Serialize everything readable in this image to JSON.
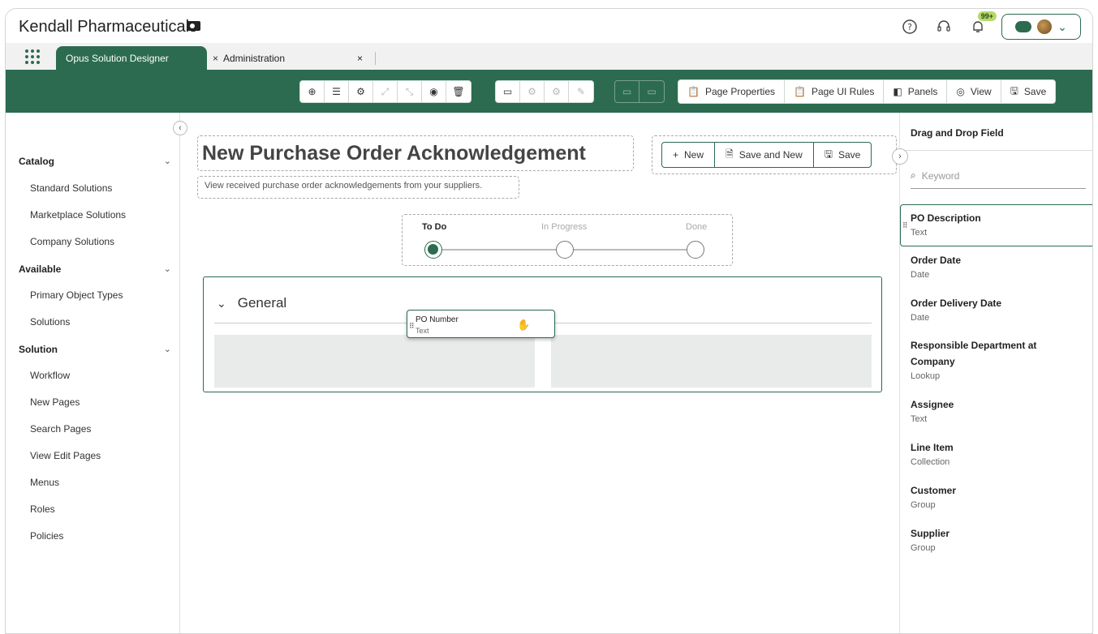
{
  "app": {
    "brand": "Kendall Pharmaceuticals",
    "notifications_badge": "99+"
  },
  "tabs": [
    {
      "label": "Opus Solution Designer",
      "close": "×"
    },
    {
      "label": "Administration",
      "close": "×"
    }
  ],
  "toolbar": {
    "page_properties": "Page Properties",
    "page_ui_rules": "Page UI Rules",
    "panels": "Panels",
    "view": "View",
    "save": "Save"
  },
  "sidebar": {
    "collapse_glyph": "‹",
    "sections": [
      {
        "title": "Catalog",
        "items": [
          "Standard Solutions",
          "Marketplace Solutions",
          "Company Solutions"
        ]
      },
      {
        "title": "Available",
        "items": [
          "Primary Object Types",
          "Solutions"
        ]
      },
      {
        "title": "Solution",
        "items": [
          "Workflow",
          "New Pages",
          "Search Pages",
          "View Edit Pages",
          "Menus",
          "Roles",
          "Policies"
        ]
      }
    ]
  },
  "canvas": {
    "title": "New Purchase Order Acknowledgement",
    "description": "View received purchase order acknowledgements from your suppliers.",
    "actions": {
      "new": "New",
      "save_and_new": "Save and New",
      "save": "Save"
    },
    "steps": [
      "To Do",
      "In Progress",
      "Done"
    ],
    "current_step": "To Do",
    "section_title": "General",
    "dragging_field": {
      "name": "PO Number",
      "type": "Text"
    }
  },
  "right_panel": {
    "expand_glyph": "›",
    "title": "Drag and Drop Field",
    "search_placeholder": "Keyword",
    "fields": [
      {
        "name": "PO Description",
        "type": "Text",
        "selected": true
      },
      {
        "name": "Order Date",
        "type": "Date"
      },
      {
        "name": "Order Delivery Date",
        "type": "Date"
      },
      {
        "name": "Responsible Department at",
        "name2": "Company",
        "type": "Lookup"
      },
      {
        "name": "Assignee",
        "type": "Text"
      },
      {
        "name": "Line Item",
        "type": "Collection"
      },
      {
        "name": "Customer",
        "type": "Group"
      },
      {
        "name": "Supplier",
        "type": "Group"
      }
    ]
  },
  "colors": {
    "brand_green": "#2c6b4f",
    "badge_green": "#b6d96a"
  }
}
